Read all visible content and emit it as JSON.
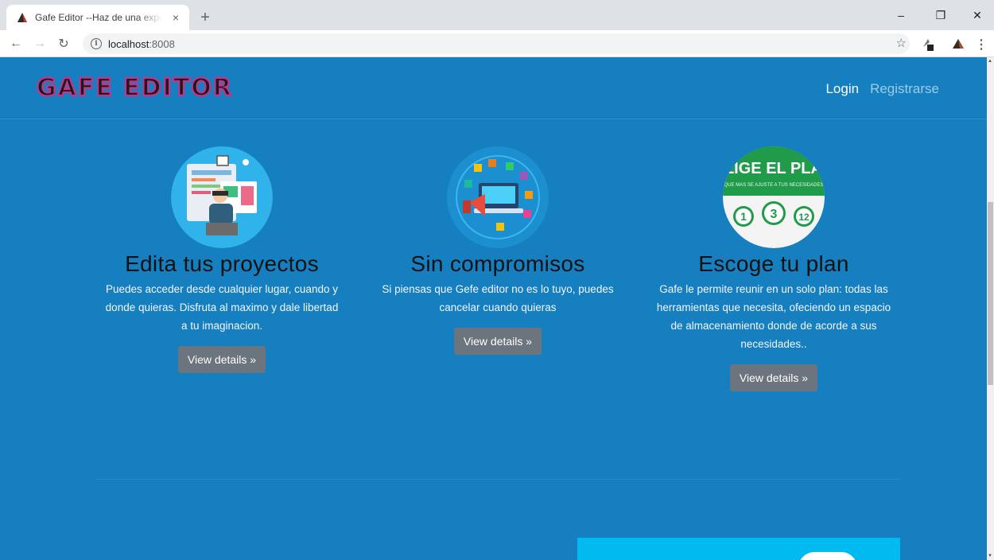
{
  "browser": {
    "tab_title": "Gafe Editor --Haz de una experie",
    "tab_close": "×",
    "new_tab": "+",
    "url_host": "localhost",
    "url_port": ":8008",
    "window_controls": {
      "minimize": "–",
      "restore": "❐",
      "close": "✕"
    }
  },
  "site": {
    "logo_text": "GAFE EDITOR",
    "nav": {
      "login": "Login",
      "register": "Registrarse"
    }
  },
  "features": [
    {
      "title": "Edita tus proyectos",
      "text": "Puedes acceder desde cualquier lugar, cuando y donde quieras. Disfruta al maximo y dale libertad a tu imaginacion.",
      "button": "View details »"
    },
    {
      "title": "Sin compromisos",
      "text": "Si piensas que Gefe editor no es lo tuyo, puedes cancelar cuando quieras",
      "button": "View details »"
    },
    {
      "title": "Escoge tu plan",
      "text": "Gafe le permite reunir en un solo plan: todas las herramientas que necesita, ofeciendo un espacio de almacenamiento donde de acorde a sus necesidades..",
      "button": "View details »",
      "image_heading": "ELIGE EL PLAN",
      "image_subheading": "QUE MAS SE AJUSTE A TUS NECESIDADES",
      "image_numbers": [
        "1",
        "3",
        "12"
      ]
    }
  ],
  "colors": {
    "page_bg": "#167fc0",
    "button_bg": "#6c757d",
    "nav_muted": "#9ccbe8"
  }
}
